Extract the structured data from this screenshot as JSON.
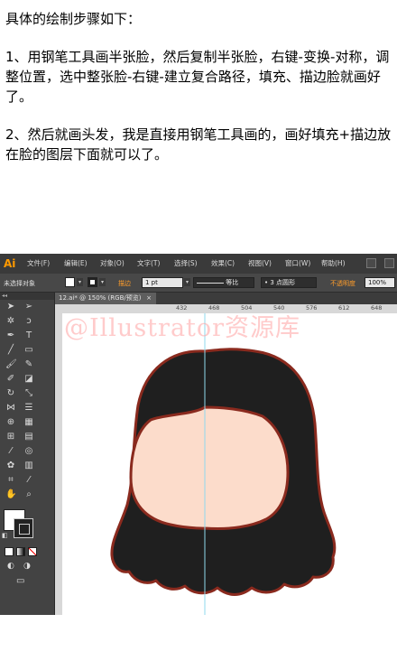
{
  "tutorial": {
    "heading": "具体的绘制步骤如下：",
    "step1": "1、用钢笔工具画半张脸，然后复制半张脸，右键-变换-对称，调整位置，选中整张脸-右键-建立复合路径，填充、描边脸就画好了。",
    "step2": "2、然后就画头发，我是直接用钢笔工具画的，画好填充+描边放在脸的图层下面就可以了。"
  },
  "app": {
    "logo": "Ai",
    "menus": [
      "文件(F)",
      "编辑(E)",
      "对象(O)",
      "文字(T)",
      "选择(S)",
      "效果(C)",
      "视图(V)",
      "窗口(W)",
      "帮助(H)"
    ]
  },
  "control_bar": {
    "selection_status": "未选择对象",
    "stroke_label": "描边",
    "stroke_weight": "1 pt",
    "profile_label": "等比",
    "brush_label": "3 点圆形",
    "opacity_label": "不透明度",
    "opacity_value": "100%"
  },
  "document": {
    "tab_label": "12.ai* @ 150% (RGB/预览)",
    "tab_close": "×",
    "ruler_ticks": [
      "432",
      "468",
      "504",
      "540",
      "576",
      "612",
      "648"
    ]
  },
  "watermark": "@Illustrator资源库",
  "colors": {
    "hair": "#1f1f1f",
    "outline": "#8a2a1e",
    "face": "#fcdccb",
    "guide": "#8fd9ec"
  },
  "icons": {
    "tools": [
      "selection-icon",
      "direct-selection-icon",
      "magic-wand-icon",
      "lasso-icon",
      "pen-icon",
      "type-icon",
      "line-icon",
      "rectangle-icon",
      "paintbrush-icon",
      "pencil-icon",
      "blob-brush-icon",
      "eraser-icon",
      "rotate-icon",
      "scale-icon",
      "width-icon",
      "warp-icon",
      "shape-builder-icon",
      "perspective-icon",
      "mesh-icon",
      "gradient-icon",
      "eyedropper-icon",
      "blend-icon",
      "symbol-sprayer-icon",
      "graph-icon",
      "artboard-icon",
      "slice-icon",
      "hand-icon",
      "zoom-icon"
    ]
  }
}
